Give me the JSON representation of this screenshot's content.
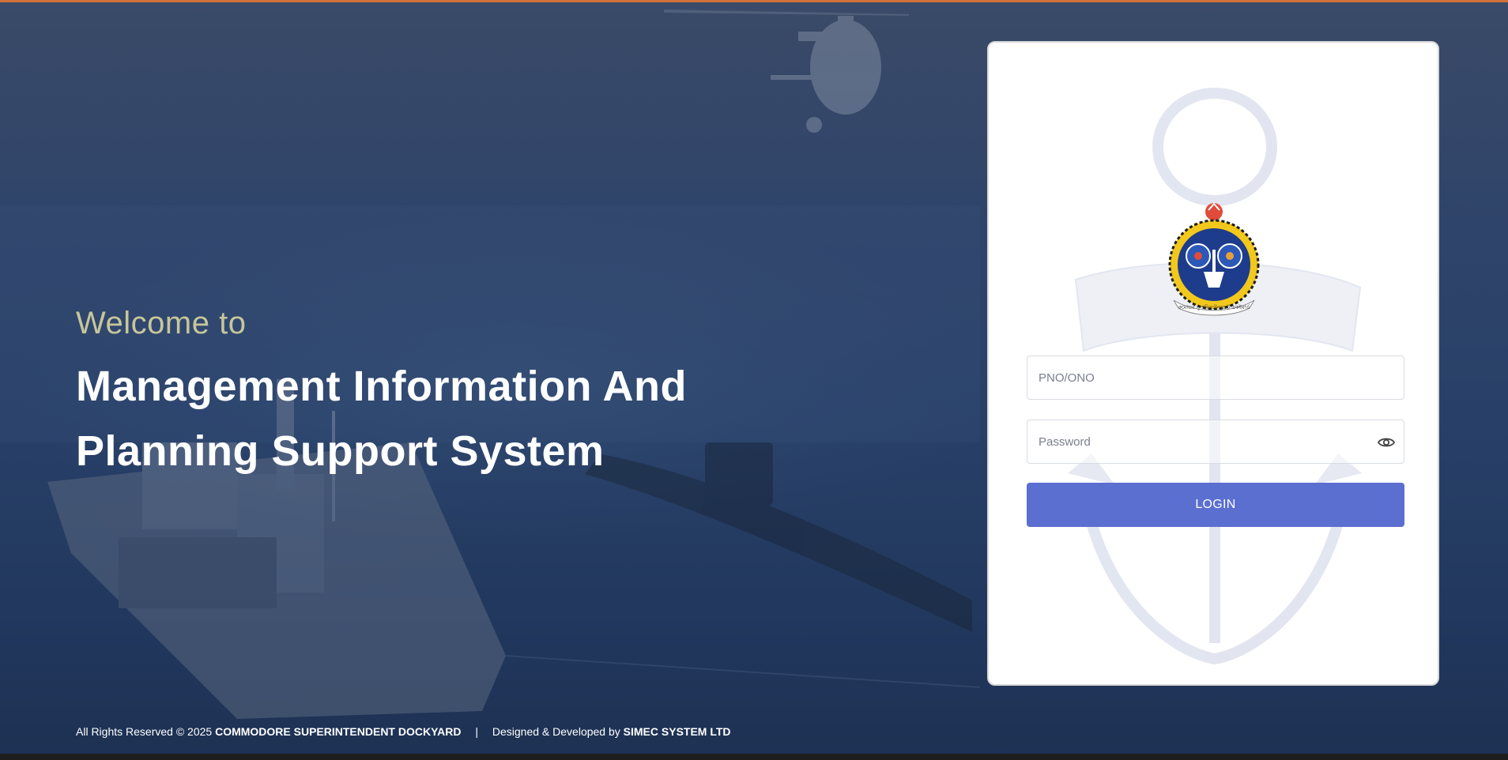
{
  "hero": {
    "welcome": "Welcome to",
    "title_line1": "Management Information And",
    "title_line2": "Planning Support System"
  },
  "login": {
    "pno_placeholder": "PNO/ONO",
    "password_placeholder": "Password",
    "login_label": "LOGIN",
    "password_toggle_icon": "eye-icon",
    "emblem_caption": "কমোডর সুপারিনটেনডেন্ট ডকইয়ার্ড"
  },
  "footer": {
    "rights_prefix": "All Rights Reserved © 2025",
    "organization": "COMMODORE SUPERINTENDENT DOCKYARD",
    "separator": "|",
    "designed_prefix": "Designed & Developed by",
    "developer": "SIMEC SYSTEM LTD"
  },
  "colors": {
    "accent_top_bar": "#d0703a",
    "login_button": "#5b6fd0",
    "welcome_text": "#c7c69a",
    "background": "#24365a"
  }
}
